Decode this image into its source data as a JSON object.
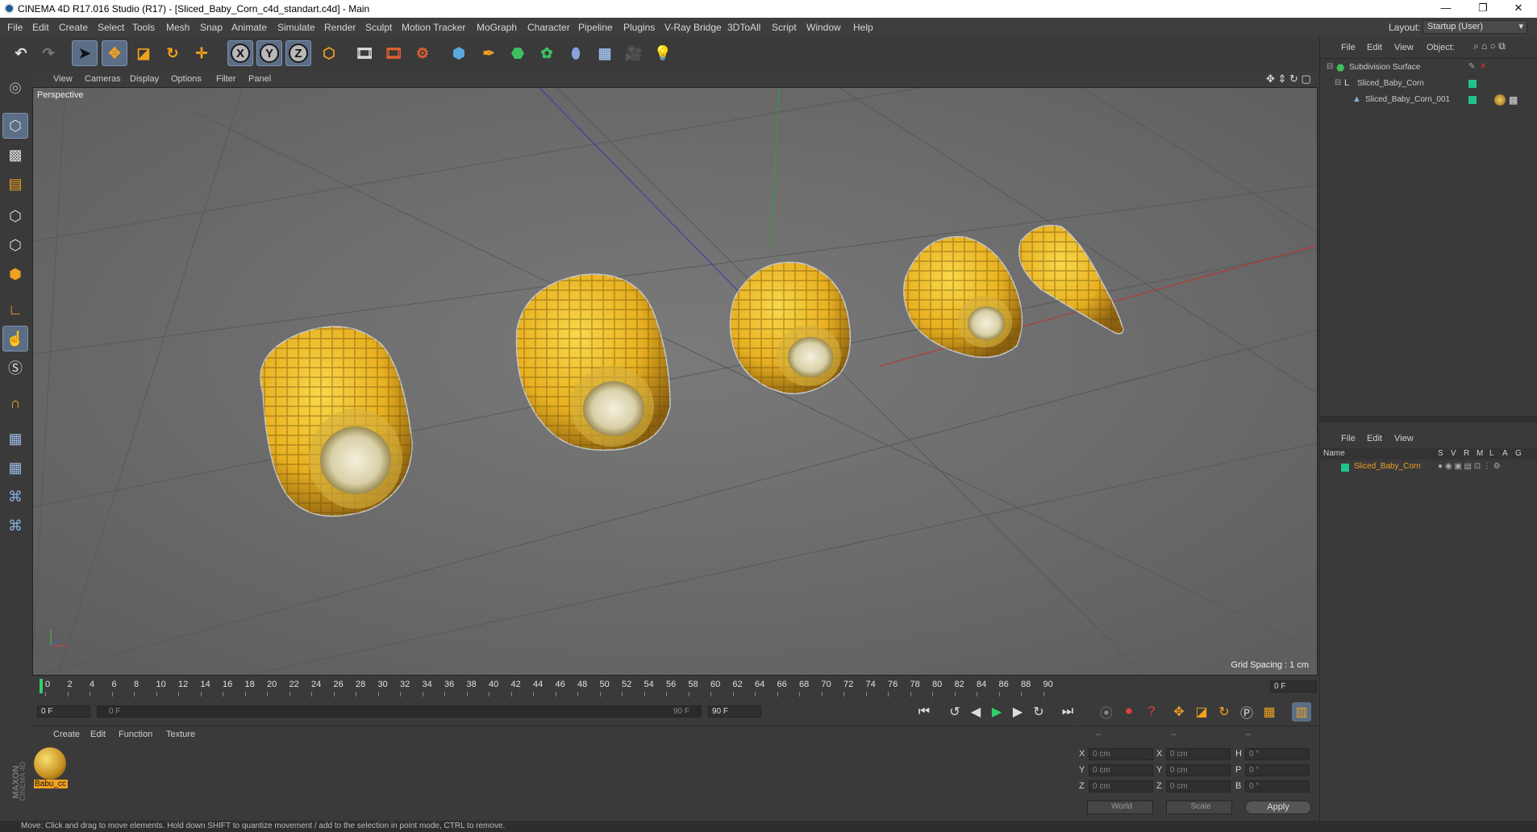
{
  "window": {
    "title": "CINEMA 4D R17.016 Studio (R17) - [Sliced_Baby_Corn_c4d_standart.c4d] - Main",
    "minimize": "—",
    "restore": "❐",
    "close": "✕"
  },
  "menu": [
    "File",
    "Edit",
    "Create",
    "Select",
    "Tools",
    "Mesh",
    "Snap",
    "Animate",
    "Simulate",
    "Render",
    "Sculpt",
    "Motion Tracker",
    "MoGraph",
    "Character",
    "Pipeline",
    "Plugins",
    "V-Ray Bridge",
    "3DToAll",
    "Script",
    "Window",
    "Help"
  ],
  "layout": {
    "label": "Layout:",
    "value": "Startup (User)"
  },
  "toolbar": {
    "x": "X",
    "y": "Y",
    "z": "Z"
  },
  "viewport": {
    "menu": [
      "View",
      "Cameras",
      "Display",
      "Options",
      "Filter",
      "Panel"
    ],
    "label": "Perspective",
    "grid_spacing": "Grid Spacing : 1 cm"
  },
  "timeline": {
    "ticks": [
      "0",
      "2",
      "4",
      "6",
      "8",
      "10",
      "12",
      "14",
      "16",
      "18",
      "20",
      "22",
      "24",
      "26",
      "28",
      "30",
      "32",
      "34",
      "36",
      "38",
      "40",
      "42",
      "44",
      "46",
      "48",
      "50",
      "52",
      "54",
      "56",
      "58",
      "60",
      "62",
      "64",
      "66",
      "68",
      "70",
      "72",
      "74",
      "76",
      "78",
      "80",
      "82",
      "84",
      "86",
      "88",
      "90"
    ],
    "current_frame": "0 F",
    "start_field": "0 F",
    "range_start": "0 F",
    "range_end": "90 F",
    "end_field": "90 F"
  },
  "material_panel": {
    "menu": [
      "Create",
      "Edit",
      "Function",
      "Texture"
    ],
    "material_name": "Babu_cc",
    "brand1": "MAXON",
    "brand2": "CINEMA 4D"
  },
  "coords": {
    "headers": [
      "--",
      "--",
      "--"
    ],
    "rows": [
      {
        "a": "X",
        "av": "0 cm",
        "b": "X",
        "bv": "0 cm",
        "c": "H",
        "cv": "0 °"
      },
      {
        "a": "Y",
        "av": "0 cm",
        "b": "Y",
        "bv": "0 cm",
        "c": "P",
        "cv": "0 °"
      },
      {
        "a": "Z",
        "av": "0 cm",
        "b": "Z",
        "bv": "0 cm",
        "c": "B",
        "cv": "0 °"
      }
    ],
    "mode1": "World",
    "mode2": "Scale",
    "apply": "Apply"
  },
  "object_manager": {
    "menu": [
      "File",
      "Edit",
      "View",
      "Object:"
    ],
    "items": [
      "Subdivision Surface",
      "Sliced_Baby_Corn",
      "Sliced_Baby_Corn_001"
    ]
  },
  "attr_manager": {
    "menu": [
      "File",
      "Edit",
      "View"
    ],
    "headers": [
      "Name",
      "S",
      "V",
      "R",
      "M",
      "L",
      "A",
      "G"
    ],
    "layer": "Sliced_Baby_Corn"
  },
  "status": "Move: Click and drag to move elements. Hold down SHIFT to quantize movement / add to the selection in point mode, CTRL to remove.",
  "colors": {
    "accent": "#5b6e86",
    "layer_green": "#1fc48a",
    "layer_text": "#f0a020"
  }
}
